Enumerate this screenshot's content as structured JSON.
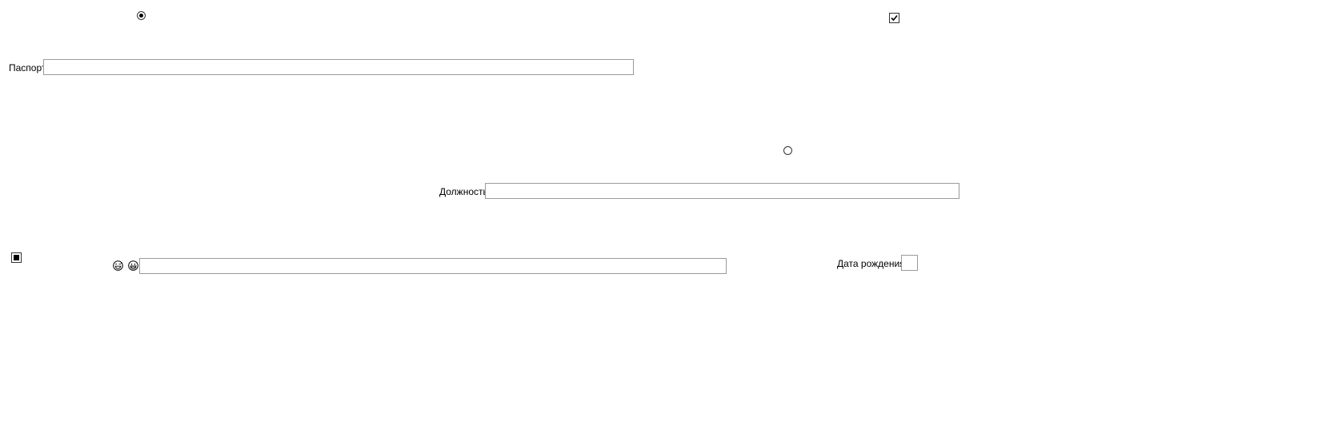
{
  "form": {
    "radio_top": {
      "checked": true
    },
    "checkbox_top_right": {
      "checked": true
    },
    "passport": {
      "label": "Паспорт",
      "value": "",
      "placeholder": ""
    },
    "radio_middle": {
      "checked": false
    },
    "position": {
      "label": "Должность",
      "value": "",
      "placeholder": ""
    },
    "checkbox_bottom_left": {
      "state": "indeterminate"
    },
    "emoji_field": {
      "icons": [
        "grinning-sweat-face-icon",
        "grinning-face-icon"
      ],
      "value": "",
      "placeholder": ""
    },
    "birth_date": {
      "label": "Дата рождения",
      "value": "",
      "placeholder": ""
    }
  }
}
